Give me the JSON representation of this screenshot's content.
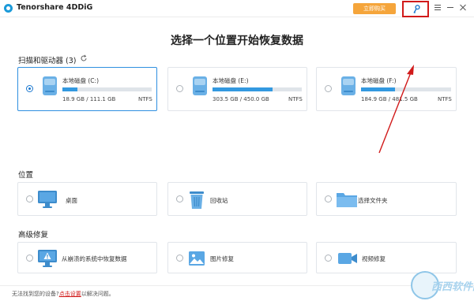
{
  "app": {
    "title": "Tenorshare 4DDiG",
    "buy_label": "立即购买"
  },
  "heading": "选择一个位置开始恢复数据",
  "drives_section": {
    "title": "扫描和驱动器 (3)"
  },
  "drives": [
    {
      "label": "本地磁盘 (C:)",
      "size": "18.9 GB / 111.1 GB",
      "fs": "NTFS",
      "used_fraction": 0.17,
      "selected": true
    },
    {
      "label": "本地磁盘 (E:)",
      "size": "303.5 GB / 450.0 GB",
      "fs": "NTFS",
      "used_fraction": 0.67,
      "selected": false
    },
    {
      "label": "本地磁盘 (F:)",
      "size": "184.9 GB / 481.5 GB",
      "fs": "NTFS",
      "used_fraction": 0.38,
      "selected": false
    }
  ],
  "locations_section": {
    "title": "位置"
  },
  "locations": [
    {
      "label": "桌面",
      "icon": "desktop-monitor-icon"
    },
    {
      "label": "回收站",
      "icon": "recycle-bin-icon"
    },
    {
      "label": "选择文件夹",
      "icon": "folder-icon"
    }
  ],
  "advanced_section": {
    "title": "高级修复"
  },
  "advanced": [
    {
      "label": "从崩溃的系统中恢复数据",
      "icon": "crashed-system-warning-icon"
    },
    {
      "label": "图片修复",
      "icon": "image-icon"
    },
    {
      "label": "视频修复",
      "icon": "video-camera-icon"
    }
  ],
  "footer": {
    "prefix": "无法找到您的设备?",
    "link": "点击设置",
    "suffix": "以解决问题。"
  },
  "watermark": {
    "text": "西西软件园"
  },
  "colors": {
    "accent": "#1b78d0",
    "bar": "#3399e0",
    "buy": "#f5a53b",
    "annotation": "#d11a1a"
  }
}
